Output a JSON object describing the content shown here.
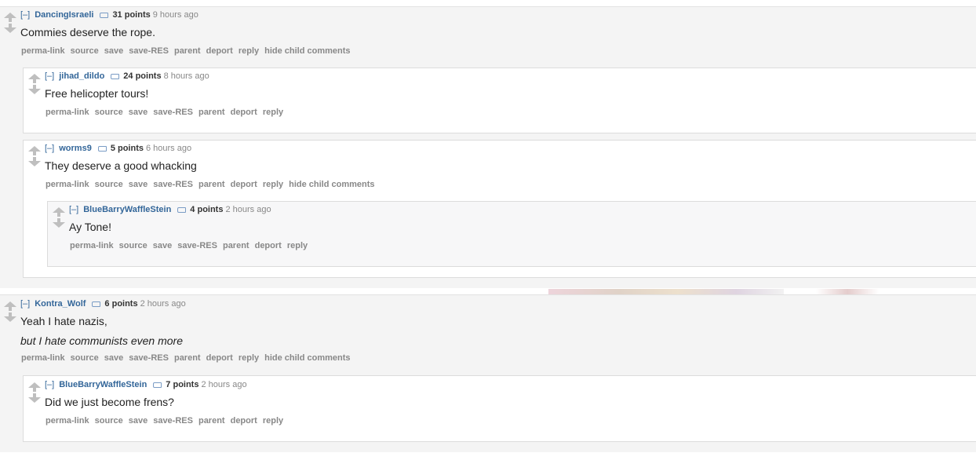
{
  "comments": {
    "c1": {
      "toggle": "[–]",
      "author": "DancingIsraeli",
      "points": "31 points",
      "time": "9 hours ago",
      "body": "Commies deserve the rope.",
      "buttons": [
        "perma-link",
        "source",
        "save",
        "save-RES",
        "parent",
        "deport",
        "reply",
        "hide child comments"
      ]
    },
    "c2": {
      "toggle": "[–]",
      "author": "jihad_dildo",
      "points": "24 points",
      "time": "8 hours ago",
      "body": "Free helicopter tours!",
      "buttons": [
        "perma-link",
        "source",
        "save",
        "save-RES",
        "parent",
        "deport",
        "reply"
      ]
    },
    "c3": {
      "toggle": "[–]",
      "author": "worms9",
      "points": "5 points",
      "time": "6 hours ago",
      "body": "They deserve a good whacking",
      "buttons": [
        "perma-link",
        "source",
        "save",
        "save-RES",
        "parent",
        "deport",
        "reply",
        "hide child comments"
      ]
    },
    "c4": {
      "toggle": "[–]",
      "author": "BlueBarryWaffleStein",
      "points": "4 points",
      "time": "2 hours ago",
      "body": "Ay Tone!",
      "buttons": [
        "perma-link",
        "source",
        "save",
        "save-RES",
        "parent",
        "deport",
        "reply"
      ]
    },
    "c5": {
      "toggle": "[–]",
      "author": "Kontra_Wolf",
      "points": "6 points",
      "time": "2 hours ago",
      "body": "Yeah I hate nazis,",
      "body2": "but I hate communists even more",
      "buttons": [
        "perma-link",
        "source",
        "save",
        "save-RES",
        "parent",
        "deport",
        "reply",
        "hide child comments"
      ]
    },
    "c6": {
      "toggle": "[–]",
      "author": "BlueBarryWaffleStein",
      "points": "7 points",
      "time": "2 hours ago",
      "body": "Did we just become frens?",
      "buttons": [
        "perma-link",
        "source",
        "save",
        "save-RES",
        "parent",
        "deport",
        "reply"
      ]
    }
  }
}
